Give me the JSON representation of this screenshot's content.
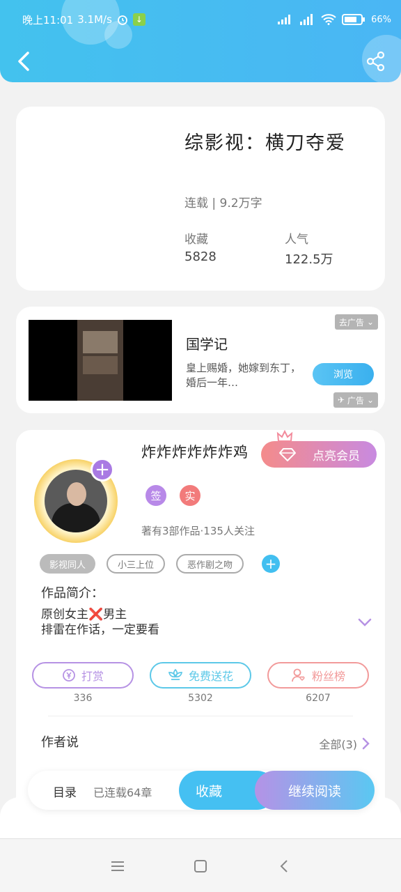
{
  "status_bar": {
    "time": "晚上11:01",
    "speed": "3.1M/s",
    "battery": "66%"
  },
  "book": {
    "title": "综影视：横刀夺爱",
    "meta": "连载 | 9.2万字",
    "collect_label": "收藏",
    "collect_value": "5828",
    "popularity_label": "人气",
    "popularity_value": "122.5万"
  },
  "ad": {
    "close_tag": "去广告",
    "title": "国学记",
    "desc": "皇上赐婚，她嫁到东丁，婚后一年…",
    "button": "浏览",
    "ad_label": "广告"
  },
  "author": {
    "name": "炸炸炸炸炸炸鸡",
    "vip_button": "点亮会员",
    "badge_sign": "签",
    "badge_real": "实",
    "info": "著有3部作品·135人关注",
    "tags": [
      "影视同人",
      "小三上位",
      "恶作剧之吻"
    ],
    "intro_label": "作品简介：",
    "intro_line1": "原创女主❌男主",
    "intro_line2": "排雷在作话，一定要看"
  },
  "actions": [
    {
      "label": "打赏",
      "count": "336",
      "color": "#b692e4"
    },
    {
      "label": "免费送花",
      "count": "5302",
      "color": "#5cc8e8"
    },
    {
      "label": "粉丝榜",
      "count": "6207",
      "color": "#f29a9a"
    }
  ],
  "author_say": {
    "label": "作者说",
    "all": "全部(3)"
  },
  "bottom": {
    "directory": "目录",
    "chapters": "已连载64章",
    "favorite": "收藏",
    "continue": "继续阅读"
  },
  "colors": {
    "header": "#45bff0",
    "accent": "#45c0f2",
    "purple": "#a97ae3",
    "pink": "#f27b7b"
  }
}
